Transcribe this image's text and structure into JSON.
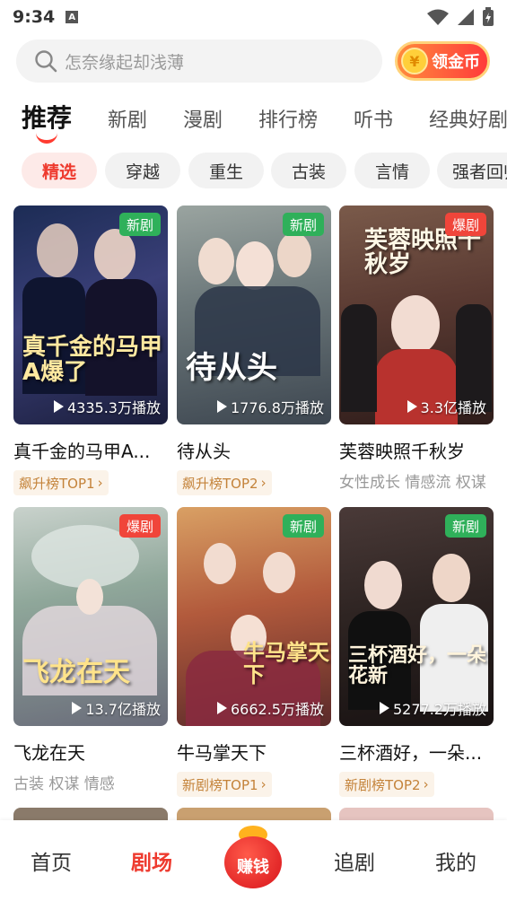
{
  "status": {
    "time": "9:34",
    "a_icon": "A"
  },
  "search": {
    "placeholder": "怎奈缘起却浅薄",
    "coin_button": "领金币",
    "coin_symbol": "¥"
  },
  "tabs": [
    "推荐",
    "新剧",
    "漫剧",
    "排行榜",
    "听书",
    "经典好剧"
  ],
  "chips": [
    "精选",
    "穿越",
    "重生",
    "古装",
    "言情",
    "强者回归"
  ],
  "cards": [
    {
      "title": "真千金的马甲A爆了",
      "display_title": "真千金的马甲A...",
      "poster_text": "真千金的马甲A爆了",
      "badge": "新剧",
      "badge_type": "new",
      "plays": "4335.3万播放",
      "tag_type": "rank",
      "tag": "飙升榜TOP1"
    },
    {
      "title": "待从头",
      "display_title": "待从头",
      "poster_text": "待从头",
      "badge": "新剧",
      "badge_type": "new",
      "plays": "1776.8万播放",
      "tag_type": "rank",
      "tag": "飙升榜TOP2"
    },
    {
      "title": "芙蓉映照千秋岁",
      "display_title": "芙蓉映照千秋岁",
      "poster_text": "芙蓉映照千秋岁",
      "badge": "爆剧",
      "badge_type": "hot",
      "plays": "3.3亿播放",
      "tag_type": "text",
      "tag": "女性成长 情感流 权谋"
    },
    {
      "title": "飞龙在天",
      "display_title": "飞龙在天",
      "poster_text": "飞龙在天",
      "badge": "爆剧",
      "badge_type": "hot",
      "plays": "13.7亿播放",
      "tag_type": "text",
      "tag": "古装 权谋 情感"
    },
    {
      "title": "牛马掌天下",
      "display_title": "牛马掌天下",
      "poster_text": "牛马掌天下",
      "badge": "新剧",
      "badge_type": "new",
      "plays": "6662.5万播放",
      "tag_type": "rank",
      "tag": "新剧榜TOP1"
    },
    {
      "title": "三杯酒好，一朵花新",
      "display_title": "三杯酒好，一朵...",
      "poster_text": "三杯酒好，一朵花新",
      "badge": "新剧",
      "badge_type": "new",
      "plays": "5277.2万播放",
      "tag_type": "rank",
      "tag": "新剧榜TOP2"
    }
  ],
  "bottom_nav": [
    "首页",
    "剧场",
    "赚钱",
    "追剧",
    "我的"
  ],
  "colors": {
    "accent": "#ee3a2e",
    "new_badge": "#2fb05a",
    "hot_badge": "#f0453a",
    "rank_tag_text": "#c4833a"
  }
}
